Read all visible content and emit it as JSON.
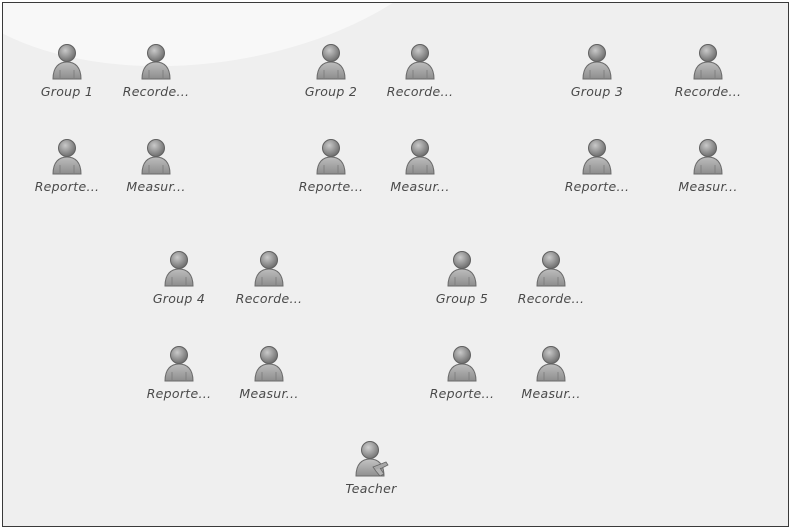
{
  "icons": {
    "student": "user-icon",
    "teacher": "teacher-icon"
  },
  "participants": [
    {
      "label": "Group 1",
      "role": "student"
    },
    {
      "label": "Recorde...",
      "role": "student"
    },
    {
      "label": "Group 2",
      "role": "student"
    },
    {
      "label": "Recorde...",
      "role": "student"
    },
    {
      "label": "Group 3",
      "role": "student"
    },
    {
      "label": "Recorde...",
      "role": "student"
    },
    {
      "label": "Reporte...",
      "role": "student"
    },
    {
      "label": "Measur...",
      "role": "student"
    },
    {
      "label": "Reporte...",
      "role": "student"
    },
    {
      "label": "Measur...",
      "role": "student"
    },
    {
      "label": "Reporte...",
      "role": "student"
    },
    {
      "label": "Measur...",
      "role": "student"
    },
    {
      "label": "Group 4",
      "role": "student"
    },
    {
      "label": "Recorde...",
      "role": "student"
    },
    {
      "label": "Group 5",
      "role": "student"
    },
    {
      "label": "Recorde...",
      "role": "student"
    },
    {
      "label": "Reporte...",
      "role": "student"
    },
    {
      "label": "Measur...",
      "role": "student"
    },
    {
      "label": "Reporte...",
      "role": "student"
    },
    {
      "label": "Measur...",
      "role": "student"
    },
    {
      "label": "Teacher",
      "role": "teacher"
    }
  ]
}
